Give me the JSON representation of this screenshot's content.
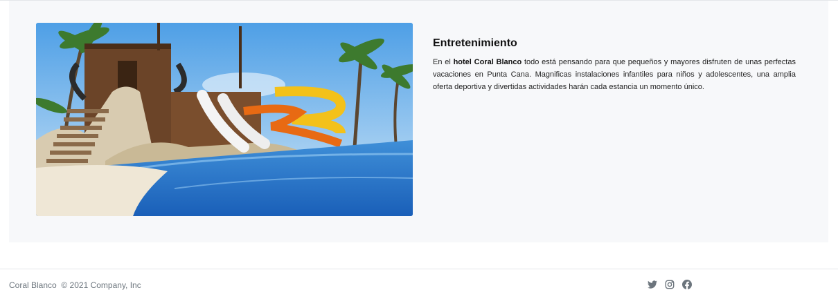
{
  "feature": {
    "heading": "Entretenimiento",
    "paragraph_prefix": "En el ",
    "hotel_name": "hotel Coral Blanco",
    "paragraph_suffix": " todo está pensando para que pequeños y mayores disfruten de unas perfectas vacaciones en Punta Cana. Magnificas instalaciones infantiles para niños y adolescentes, una amplia oferta deportiva y divertidas actividades harán cada estancia un momento único.",
    "image_icon": "water-park-photo"
  },
  "footer": {
    "brand": "Coral Blanco",
    "copyright": "© 2021 Company, Inc",
    "social": [
      {
        "icon": "twitter-icon"
      },
      {
        "icon": "instagram-icon"
      },
      {
        "icon": "facebook-icon"
      }
    ]
  }
}
